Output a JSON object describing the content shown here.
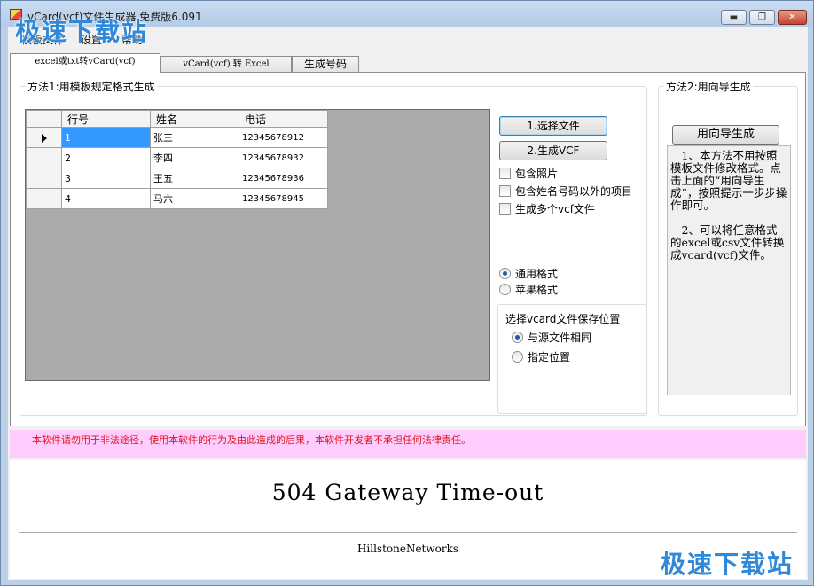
{
  "window": {
    "title": "vCard(vcf)文件生成器 免费版6.091",
    "watermark": "极速下载站",
    "controls": {
      "minimize": "▬",
      "maximize": "❐",
      "close": "✕"
    }
  },
  "menu": {
    "items": [
      "模板文件",
      "设置",
      "帮助"
    ]
  },
  "tabs": [
    "excel或txt转vCard(vcf)",
    "vCard(vcf) 转 Excel",
    "生成号码"
  ],
  "method1": {
    "title": "方法1:用模板规定格式生成",
    "grid": {
      "columns": [
        "行号",
        "姓名",
        "电话"
      ],
      "rows": [
        [
          "1",
          "张三",
          "12345678912"
        ],
        [
          "2",
          "李四",
          "12345678932"
        ],
        [
          "3",
          "王五",
          "12345678936"
        ],
        [
          "4",
          "马六",
          "12345678945"
        ]
      ]
    },
    "buttons": {
      "choose_file": "1.选择文件",
      "generate": "2.生成VCF"
    },
    "options": [
      "包含照片",
      "包含姓名号码以外的项目",
      "生成多个vcf文件"
    ],
    "format": {
      "options": [
        "通用格式",
        "苹果格式"
      ],
      "selected": "通用格式"
    },
    "save": {
      "title": "选择vcard文件保存位置",
      "options": [
        "与源文件相同",
        "指定位置"
      ],
      "selected": "与源文件相同"
    }
  },
  "method2": {
    "title": "方法2:用向导生成",
    "button": "用向导生成",
    "description": [
      "　1、本方法不用按照模板文件修改格式。点击上面的“用向导生成”，按照提示一步步操作即可。",
      "　2、可以将任意格式的excel或csv文件转换成vcard(vcf)文件。"
    ]
  },
  "banner": {
    "text": "本软件请勿用于非法途径，使用本软件的行为及由此造成的后果，本软件开发者不承担任何法律责任。",
    "color": "#e0161b",
    "background": "#ffccff"
  },
  "webpanel": {
    "title": "504 Gateway Time-out",
    "footer": "HillstoneNetworks"
  }
}
